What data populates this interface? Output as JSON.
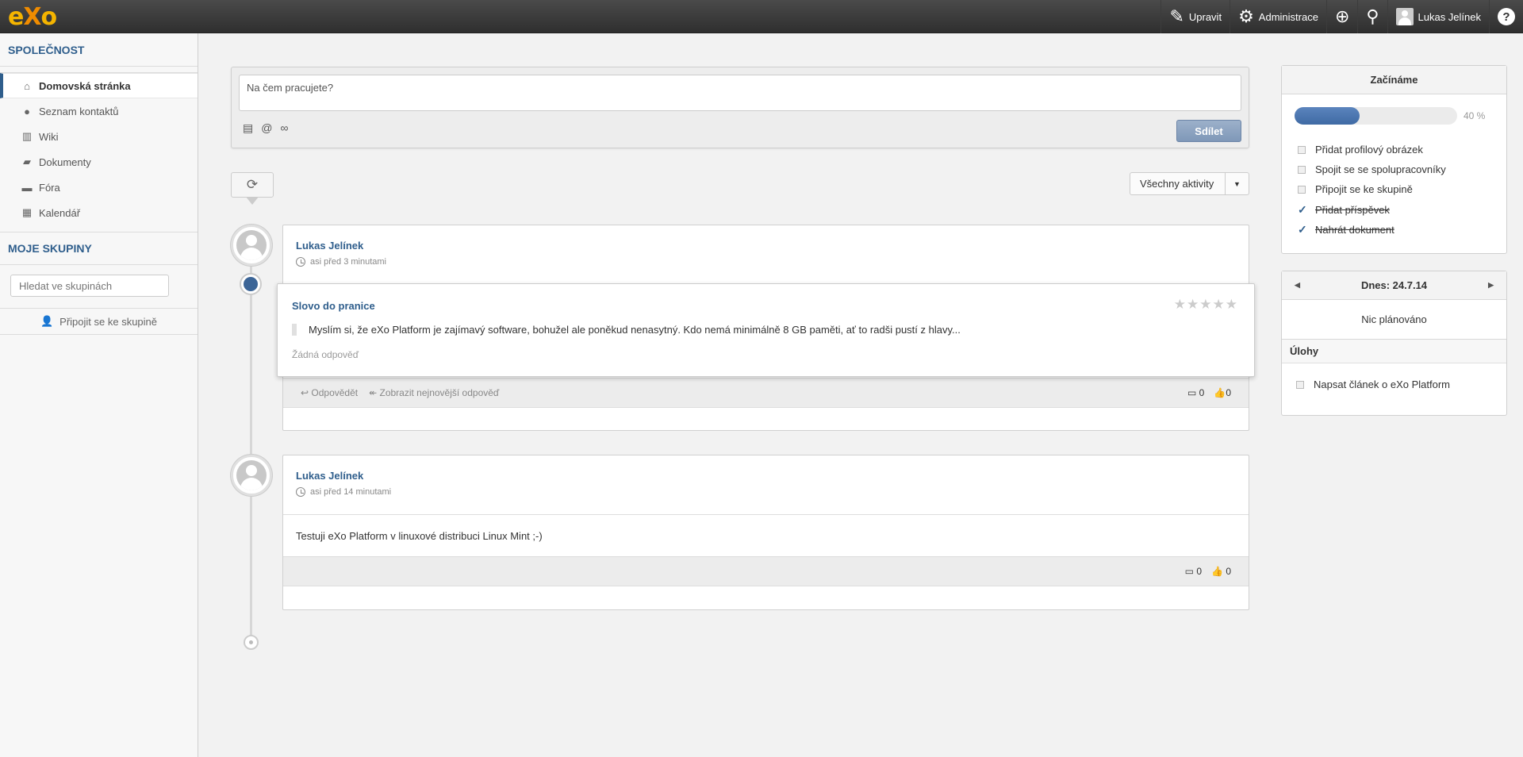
{
  "topbar": {
    "logo": "eXo",
    "edit_label": "Upravit",
    "admin_label": "Administrace",
    "user_name": "Lukas Jelínek",
    "help_label": "?"
  },
  "sidebar": {
    "company_heading": "SPOLEČNOST",
    "items": [
      {
        "label": "Domovská stránka",
        "icon": "home-icon"
      },
      {
        "label": "Seznam kontaktů",
        "icon": "person-icon"
      },
      {
        "label": "Wiki",
        "icon": "book-icon"
      },
      {
        "label": "Dokumenty",
        "icon": "folder-icon"
      },
      {
        "label": "Fóra",
        "icon": "chat-icon"
      },
      {
        "label": "Kalendář",
        "icon": "calendar-icon"
      }
    ],
    "groups_heading": "MOJE SKUPINY",
    "group_search_placeholder": "Hledat ve skupinách",
    "join_group": "Připojit se ke skupině"
  },
  "composer": {
    "placeholder": "Na čem pracujete?",
    "share_label": "Sdílet"
  },
  "filter": {
    "label": "Všechny aktivity"
  },
  "activities": [
    {
      "author": "Lukas Jelínek",
      "time": "asi před 3 minutami",
      "forum": {
        "title": "Slovo do pranice",
        "text": "Myslím si, že eXo Platform je zajímavý software, bohužel ale poněkud nenasytný. Kdo nemá minimálně 8 GB paměti, ať to radši pustí z hlavy...",
        "reply_status": "Žádná odpověď"
      },
      "reply_label": "Odpovědět",
      "latest_reply_label": "Zobrazit nejnovější odpověď",
      "comments": "0",
      "likes": "0"
    },
    {
      "author": "Lukas Jelínek",
      "time": "asi před 14 minutami",
      "text": "Testuji eXo Platform v linuxové distribuci Linux Mint ;-)",
      "comments": "0",
      "likes": "0"
    }
  ],
  "getting_started": {
    "title": "Začínáme",
    "progress": 40,
    "progress_label": "40 %",
    "items": [
      {
        "label": "Přidat profilový obrázek",
        "done": false
      },
      {
        "label": "Spojit se se spolupracovníky",
        "done": false
      },
      {
        "label": "Připojit se ke skupině",
        "done": false
      },
      {
        "label": "Přidat příspěvek",
        "done": true
      },
      {
        "label": "Nahrát dokument",
        "done": true
      }
    ]
  },
  "calendar": {
    "date_label": "Dnes: 24.7.14",
    "nothing_planned": "Nic plánováno",
    "tasks_heading": "Úlohy",
    "tasks": [
      "Napsat článek o eXo Platform"
    ]
  },
  "colors": {
    "accent": "#2f5e8c",
    "logo": "#f4b400",
    "progress": "#4a73ad"
  }
}
